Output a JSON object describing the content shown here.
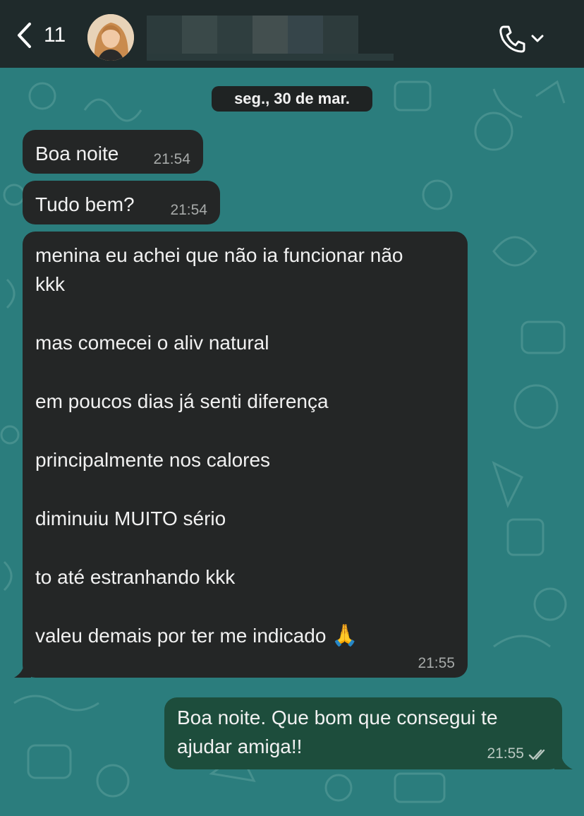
{
  "header": {
    "back_count": "11",
    "contact_name": ""
  },
  "chat": {
    "date_label": "seg., 30 de mar.",
    "messages": [
      {
        "text": "Boa noite",
        "time": "21:54"
      },
      {
        "text": "Tudo bem?",
        "time": "21:54"
      },
      {
        "lines": [
          "menina eu achei que não ia funcionar não",
          "kkk",
          "mas comecei o aliv natural",
          "em poucos dias já senti diferença",
          "principalmente nos calores",
          "diminuiu MUITO sério",
          "to até estranhando kkk",
          "valeu demais por ter me indicado"
        ],
        "emoji": "🙏",
        "time": "21:55"
      },
      {
        "lines": [
          "Boa noite. Que bom que consegui te",
          "ajudar amiga!!"
        ],
        "time": "21:55"
      }
    ]
  },
  "icons": [
    "back-chevron-icon",
    "phone-icon",
    "chevron-down-icon",
    "double-check-icon",
    "praying-hands-emoji"
  ],
  "colors": {
    "header_bg": "#1f2a2b",
    "chat_bg": "#2b7d7d",
    "incoming_bubble": "#242626",
    "outgoing_bubble": "#1d4d3c"
  }
}
